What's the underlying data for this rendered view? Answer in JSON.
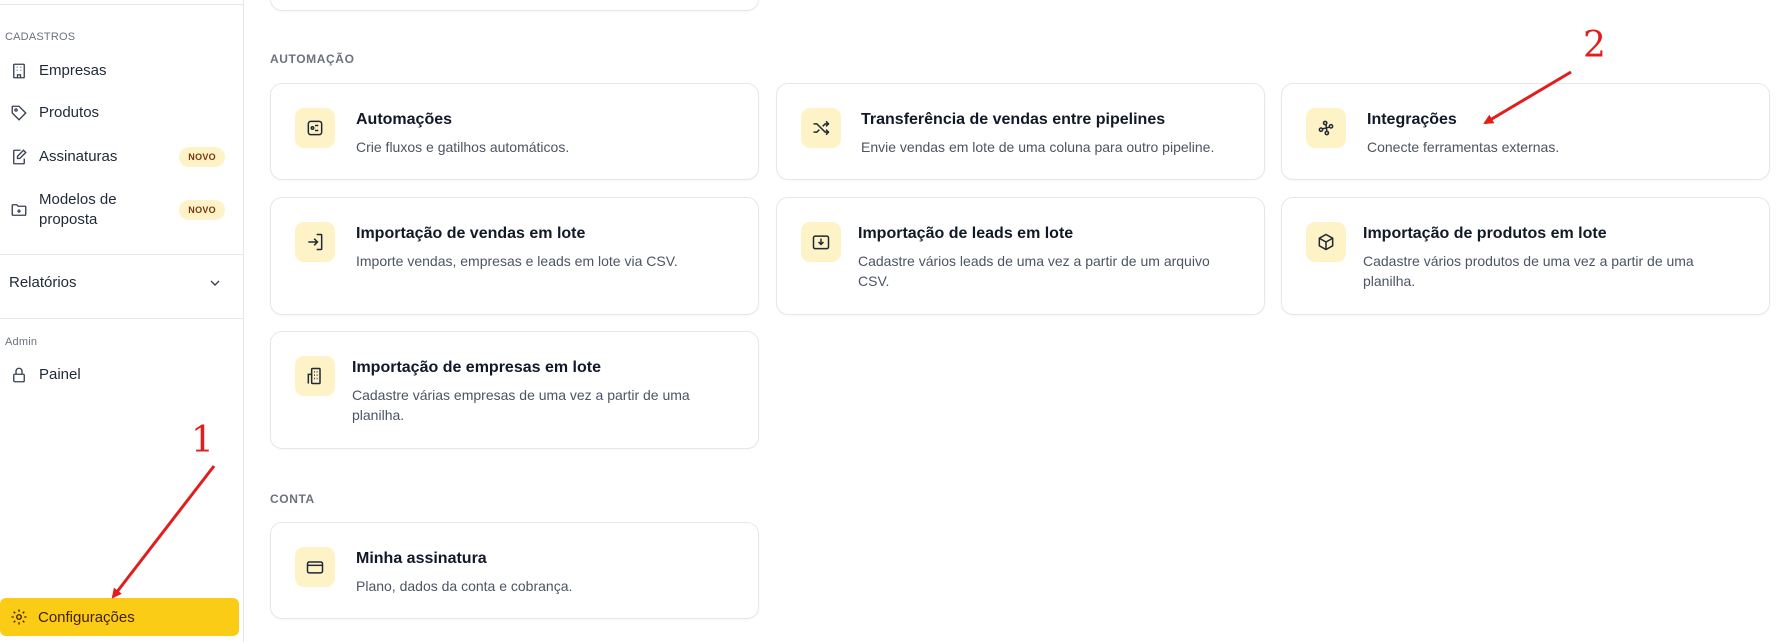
{
  "sidebar": {
    "cadastros_label": "CADASTROS",
    "items": [
      {
        "label": "Empresas",
        "icon": "building-icon"
      },
      {
        "label": "Produtos",
        "icon": "tag-icon"
      },
      {
        "label": "Assinaturas",
        "icon": "signature-icon",
        "badge": "NOVO"
      },
      {
        "label": "Modelos de proposta",
        "icon": "folder-plus-icon",
        "badge": "NOVO"
      }
    ],
    "relatorios_label": "Relatórios",
    "admin_label": "Admin",
    "painel_label": "Painel",
    "config_label": "Configurações"
  },
  "main": {
    "automacao_title": "AUTOMAÇÃO",
    "cards": [
      {
        "title": "Automações",
        "desc": "Crie fluxos e gatilhos automáticos."
      },
      {
        "title": "Transferência de vendas entre pipelines",
        "desc": "Envie vendas em lote de uma coluna para outro pipeline."
      },
      {
        "title": "Integrações",
        "desc": "Conecte ferramentas externas."
      },
      {
        "title": "Importação de vendas em lote",
        "desc": "Importe vendas, empresas e leads em lote via CSV."
      },
      {
        "title": "Importação de leads em lote",
        "desc": "Cadastre vários leads de uma vez a partir de um arquivo CSV."
      },
      {
        "title": "Importação de produtos em lote",
        "desc": "Cadastre vários produtos de uma vez a partir de uma planilha."
      },
      {
        "title": "Importação de empresas em lote",
        "desc": "Cadastre várias empresas de uma vez a partir de uma planilha."
      }
    ],
    "conta_title": "CONTA",
    "conta_card": {
      "title": "Minha assinatura",
      "desc": "Plano, dados da conta e cobrança."
    }
  },
  "annotations": {
    "one": "1",
    "two": "2",
    "color": "#e11d1d"
  },
  "colors": {
    "accent": "#facc15",
    "icon_bg": "#fef3c7"
  }
}
